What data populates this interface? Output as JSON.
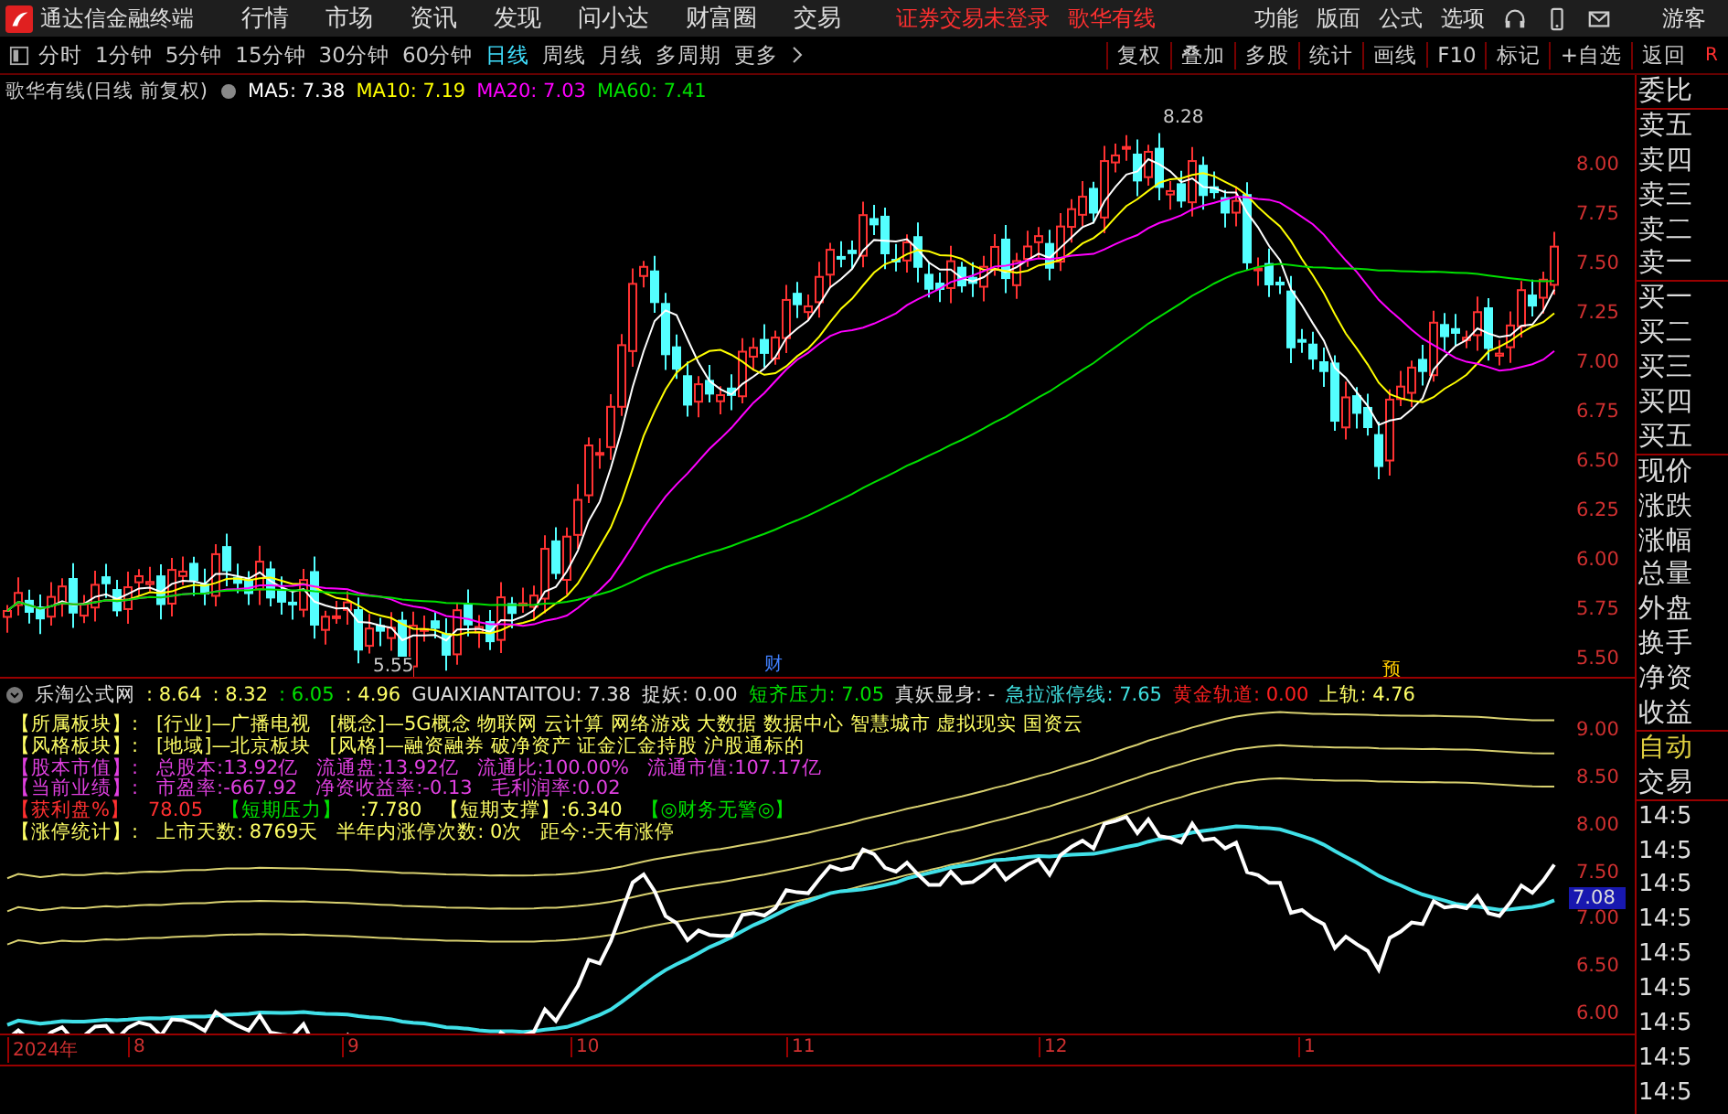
{
  "app_bar": {
    "app_name": "通达信金融终端",
    "menus": [
      "行情",
      "市场",
      "资讯",
      "发现",
      "问小达",
      "财富圈",
      "交易"
    ],
    "notices": [
      "证券交易未登录",
      "歌华有线"
    ],
    "right_menus": [
      "功能",
      "版面",
      "公式",
      "选项"
    ],
    "user": "游客"
  },
  "period_bar": {
    "periods": [
      {
        "label": "分时",
        "selected": false
      },
      {
        "label": "1分钟",
        "selected": false
      },
      {
        "label": "5分钟",
        "selected": false
      },
      {
        "label": "15分钟",
        "selected": false
      },
      {
        "label": "30分钟",
        "selected": false
      },
      {
        "label": "60分钟",
        "selected": false
      },
      {
        "label": "日线",
        "selected": true
      },
      {
        "label": "周线",
        "selected": false
      },
      {
        "label": "月线",
        "selected": false
      },
      {
        "label": "多周期",
        "selected": false
      }
    ],
    "more": "更多",
    "tools": [
      "复权",
      "叠加",
      "多股",
      "统计",
      "画线",
      "F10",
      "标记",
      "+自选",
      "返回"
    ],
    "corner": "R"
  },
  "main_chart": {
    "title": "歌华有线(日线 前复权)",
    "mas": [
      {
        "text": "MA5: 7.38",
        "color": "#ffffff"
      },
      {
        "text": "MA10: 7.19",
        "color": "#ffff00"
      },
      {
        "text": "MA20: 7.03",
        "color": "#ff00ff"
      },
      {
        "text": "MA60: 7.41",
        "color": "#00e000"
      }
    ],
    "y_labels": [
      "8.00",
      "7.75",
      "7.50",
      "7.25",
      "7.00",
      "6.75",
      "6.50",
      "6.25",
      "6.00",
      "5.75",
      "5.50"
    ],
    "high_label": "8.28",
    "low_label": "5.55",
    "markers": [
      "财",
      "预"
    ]
  },
  "indicator": {
    "name": "乐淘公式网",
    "readings": [
      {
        "text": ": 8.64",
        "color": "#ffff66"
      },
      {
        "text": ": 8.32",
        "color": "#ffff66"
      },
      {
        "text": ": 6.05",
        "color": "#00e000"
      },
      {
        "text": ": 4.96",
        "color": "#ffff66"
      },
      {
        "text": "GUAIXIANTAITOU: 7.38",
        "color": "#e0e0e0"
      },
      {
        "text": "捉妖: 0.00",
        "color": "#e0e0e0"
      },
      {
        "text": "短齐压力: 7.05",
        "color": "#00e000"
      },
      {
        "text": "真妖显身: -",
        "color": "#e0e0e0"
      },
      {
        "text": "急拉涨停线: 7.65",
        "color": "#40e0e0"
      },
      {
        "text": "黄金轨道: 0.00",
        "color": "#ff2020"
      },
      {
        "text": "上轨: 4.76",
        "color": "#ffff66"
      }
    ],
    "info_lines": [
      {
        "segments": [
          {
            "text": "【所属板块】:",
            "color": "#ffff66"
          },
          {
            "text": "[行业]—广播电视",
            "color": "#ffff66"
          },
          {
            "text": "[概念]—5G概念 物联网 云计算 网络游戏 大数据 数据中心 智慧城市 虚拟现实 国资云",
            "color": "#ffff66"
          }
        ]
      },
      {
        "segments": [
          {
            "text": "【风格板块】:",
            "color": "#ffff66"
          },
          {
            "text": "[地域]—北京板块",
            "color": "#ffff66"
          },
          {
            "text": "[风格]—融资融券 破净资产 证金汇金持股 沪股通标的",
            "color": "#ffff66"
          }
        ]
      },
      {
        "segments": [
          {
            "text": "【股本市值】:",
            "color": "#e040e0"
          },
          {
            "text": "总股本:13.92亿",
            "color": "#e040e0"
          },
          {
            "text": "流通盘:13.92亿",
            "color": "#e040e0"
          },
          {
            "text": "流通比:100.00%",
            "color": "#e040e0"
          },
          {
            "text": "流通市值:107.17亿",
            "color": "#e040e0"
          }
        ]
      },
      {
        "segments": [
          {
            "text": "【当前业绩】:",
            "color": "#e040e0"
          },
          {
            "text": "市盈率:-667.92",
            "color": "#e040e0"
          },
          {
            "text": "净资收益率:-0.13",
            "color": "#e040e0"
          },
          {
            "text": "毛利润率:0.02",
            "color": "#e040e0"
          }
        ]
      },
      {
        "segments": [
          {
            "text": "【获利盘%】",
            "color": "#ff3030"
          },
          {
            "text": "78.05",
            "color": "#ff3030"
          },
          {
            "text": "【短期压力】",
            "color": "#00e000"
          },
          {
            "text": ":7.780",
            "color": "#ffff66"
          },
          {
            "text": "【短期支撑】:6.340",
            "color": "#ffff66"
          },
          {
            "text": "【◎财务无警◎】",
            "color": "#00e000"
          }
        ]
      },
      {
        "segments": [
          {
            "text": "【涨停统计】:",
            "color": "#ffff66"
          },
          {
            "text": "上市天数: 8769天",
            "color": "#ffff66"
          },
          {
            "text": "半年内涨停次数: 0次",
            "color": "#ffff66"
          },
          {
            "text": "距今:-天有涨停",
            "color": "#ffff66"
          }
        ]
      }
    ],
    "y_labels": [
      "9.00",
      "8.50",
      "8.00",
      "7.50",
      "7.00",
      "6.50",
      "6.00"
    ],
    "last_price": "7.08"
  },
  "date_axis": [
    "2024年",
    "8",
    "9",
    "10",
    "11",
    "12",
    "1"
  ],
  "sidebar": {
    "quote_labels": [
      "委比",
      "卖五",
      "卖四",
      "卖三",
      "卖二",
      "卖一",
      "买一",
      "买二",
      "买三",
      "买四",
      "买五",
      "现价",
      "涨跌",
      "涨幅",
      "总量",
      "外盘",
      "换手",
      "净资",
      "收益"
    ],
    "trade_labels": [
      "自动",
      "交易"
    ],
    "times": [
      "14:5",
      "14:5",
      "14:5",
      "14:5",
      "14:5",
      "14:5",
      "14:5",
      "14:5",
      "14:5"
    ]
  }
}
